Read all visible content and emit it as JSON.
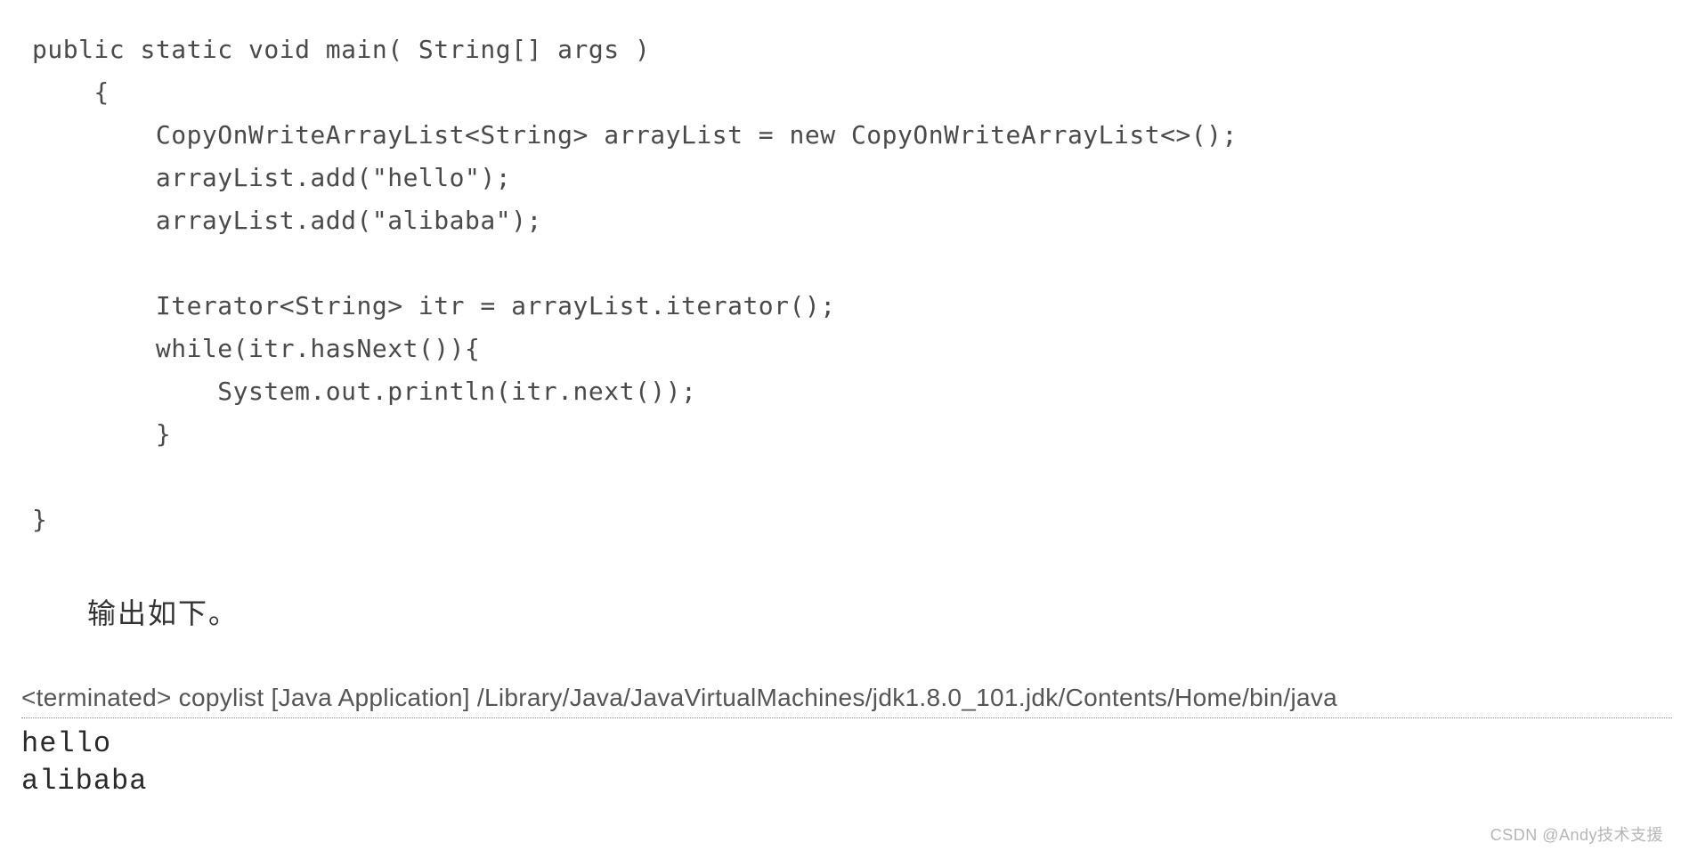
{
  "code": {
    "lines": [
      "public static void main( String[] args )",
      "    {",
      "        CopyOnWriteArrayList<String> arrayList = new CopyOnWriteArrayList<>();",
      "        arrayList.add(\"hello\");",
      "        arrayList.add(\"alibaba\");",
      "",
      "        Iterator<String> itr = arrayList.iterator();",
      "        while(itr.hasNext()){",
      "            System.out.println(itr.next());",
      "        }",
      "",
      "}"
    ]
  },
  "caption": "输出如下。",
  "console": {
    "header": "<terminated> copylist [Java Application] /Library/Java/JavaVirtualMachines/jdk1.8.0_101.jdk/Contents/Home/bin/java",
    "output": [
      "hello",
      "alibaba"
    ]
  },
  "watermark": "CSDN @Andy技术支援"
}
